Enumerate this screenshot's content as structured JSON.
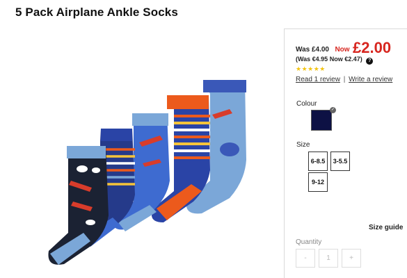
{
  "product": {
    "title": "5 Pack Airplane Ankle Socks"
  },
  "pricing": {
    "was_text": "Was £4.00",
    "now_label": "Now",
    "now_price": "£2.00",
    "euro_text": "(Was €4.95 Now €2.47)",
    "help_glyph": "?"
  },
  "reviews": {
    "stars_glyph": "★★★★★",
    "rating": 5,
    "read_link": "Read 1 review",
    "separator": "|",
    "write_link": "Write a review"
  },
  "colour": {
    "label": "Colour",
    "selected_swatch": "#0d1144",
    "check_glyph": "✓"
  },
  "size": {
    "label": "Size",
    "options": [
      "6-8.5",
      "3-5.5",
      "9-12"
    ],
    "guide_label": "Size guide"
  },
  "quantity": {
    "label": "Quantity",
    "minus": "-",
    "value": "1",
    "plus": "+"
  },
  "colors": {
    "price_red": "#d7261f",
    "star_yellow": "#f3c412"
  }
}
